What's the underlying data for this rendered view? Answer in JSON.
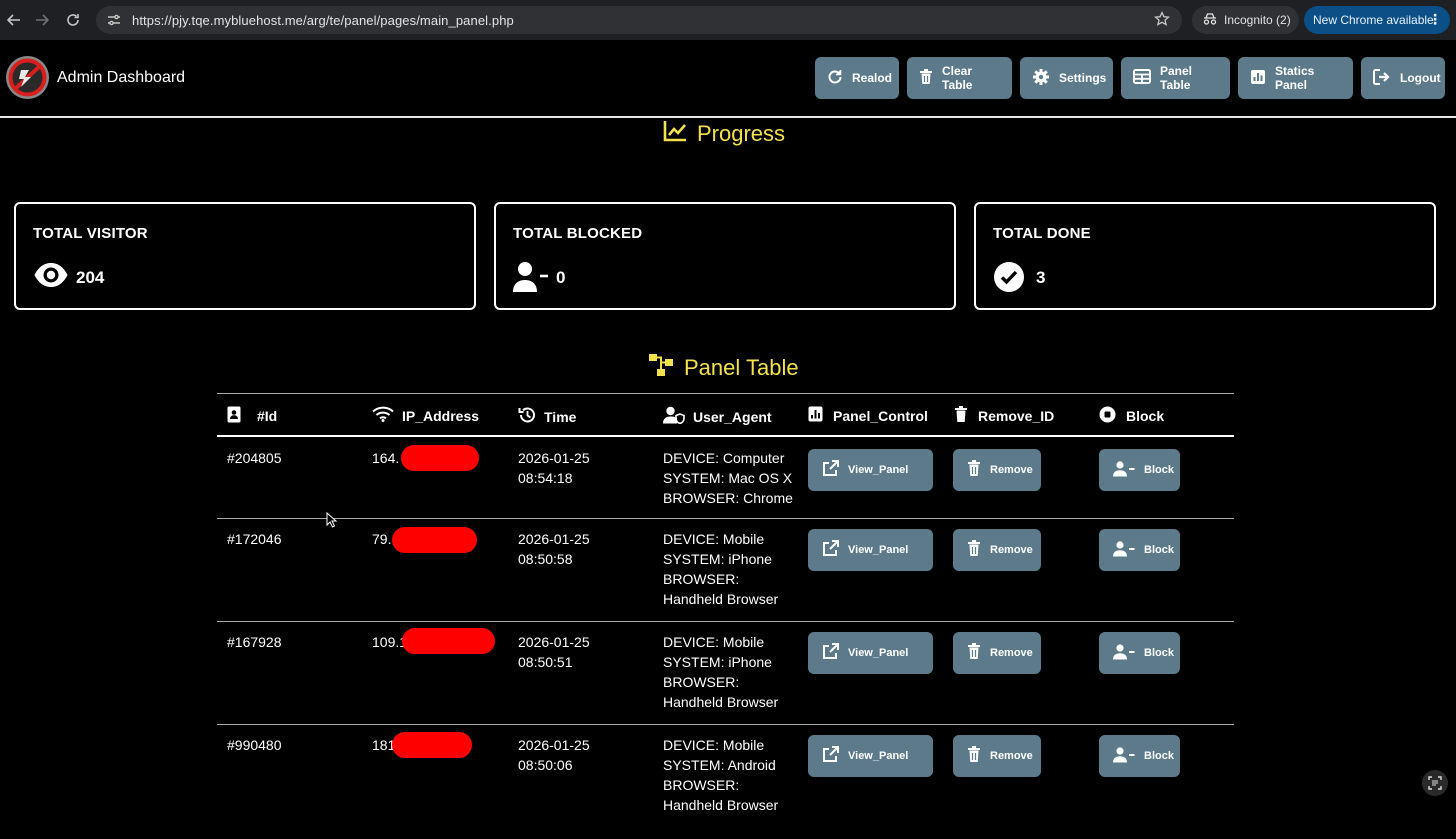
{
  "browser": {
    "url": "https://pjy.tqe.mybluehost.me/arg/te/panel/pages/main_panel.php",
    "incognito_label": "Incognito (2)",
    "update_label": "New Chrome available"
  },
  "header": {
    "brand": "Admin Dashboard",
    "buttons": [
      {
        "label": "Realod",
        "icon": "reload-icon"
      },
      {
        "label": "Clear Table",
        "icon": "trash-icon"
      },
      {
        "label": "Settings",
        "icon": "gear-icon"
      },
      {
        "label": "Panel Table",
        "icon": "table-icon"
      },
      {
        "label": "Statics Panel",
        "icon": "bar-chart-icon"
      },
      {
        "label": "Logout",
        "icon": "logout-icon"
      }
    ]
  },
  "progress": {
    "title": "Progress",
    "cards": [
      {
        "label": "TOTAL VISITOR",
        "value": "204",
        "icon": "eye-icon"
      },
      {
        "label": "TOTAL BLOCKED",
        "value": "0",
        "icon": "user-minus-icon"
      },
      {
        "label": "TOTAL DONE",
        "value": "3",
        "icon": "check-circle-icon"
      }
    ]
  },
  "panel_table": {
    "title": "Panel Table",
    "columns": [
      {
        "label": "#Id",
        "icon": "id-card-icon"
      },
      {
        "label": "IP_Address",
        "icon": "wifi-icon"
      },
      {
        "label": "Time",
        "icon": "history-icon"
      },
      {
        "label": "User_Agent",
        "icon": "user-shield-icon"
      },
      {
        "label": "Panel_Control",
        "icon": "chart-square-icon"
      },
      {
        "label": "Remove_ID",
        "icon": "trash-icon"
      },
      {
        "label": "Block",
        "icon": "stop-circle-icon"
      }
    ],
    "rows": [
      {
        "id": "#204805",
        "ip": "164.",
        "date": "2026-01-25",
        "time": "08:54:18",
        "ua": [
          "DEVICE: Computer",
          "SYSTEM: Mac OS X",
          "BROWSER: Chrome"
        ]
      },
      {
        "id": "#172046",
        "ip": "79.",
        "date": "2026-01-25",
        "time": "08:50:58",
        "ua": [
          "DEVICE: Mobile",
          "SYSTEM: iPhone",
          "BROWSER:",
          "Handheld Browser"
        ]
      },
      {
        "id": "#167928",
        "ip": "109.1",
        "date": "2026-01-25",
        "time": "08:50:51",
        "ua": [
          "DEVICE: Mobile",
          "SYSTEM: iPhone",
          "BROWSER:",
          "Handheld Browser"
        ]
      },
      {
        "id": "#990480",
        "ip": "181",
        "date": "2026-01-25",
        "time": "08:50:06",
        "ua": [
          "DEVICE: Mobile",
          "SYSTEM: Android",
          "BROWSER:",
          "Handheld Browser"
        ]
      }
    ],
    "actions": {
      "view": "View_Panel",
      "remove": "Remove",
      "block": "Block"
    }
  }
}
